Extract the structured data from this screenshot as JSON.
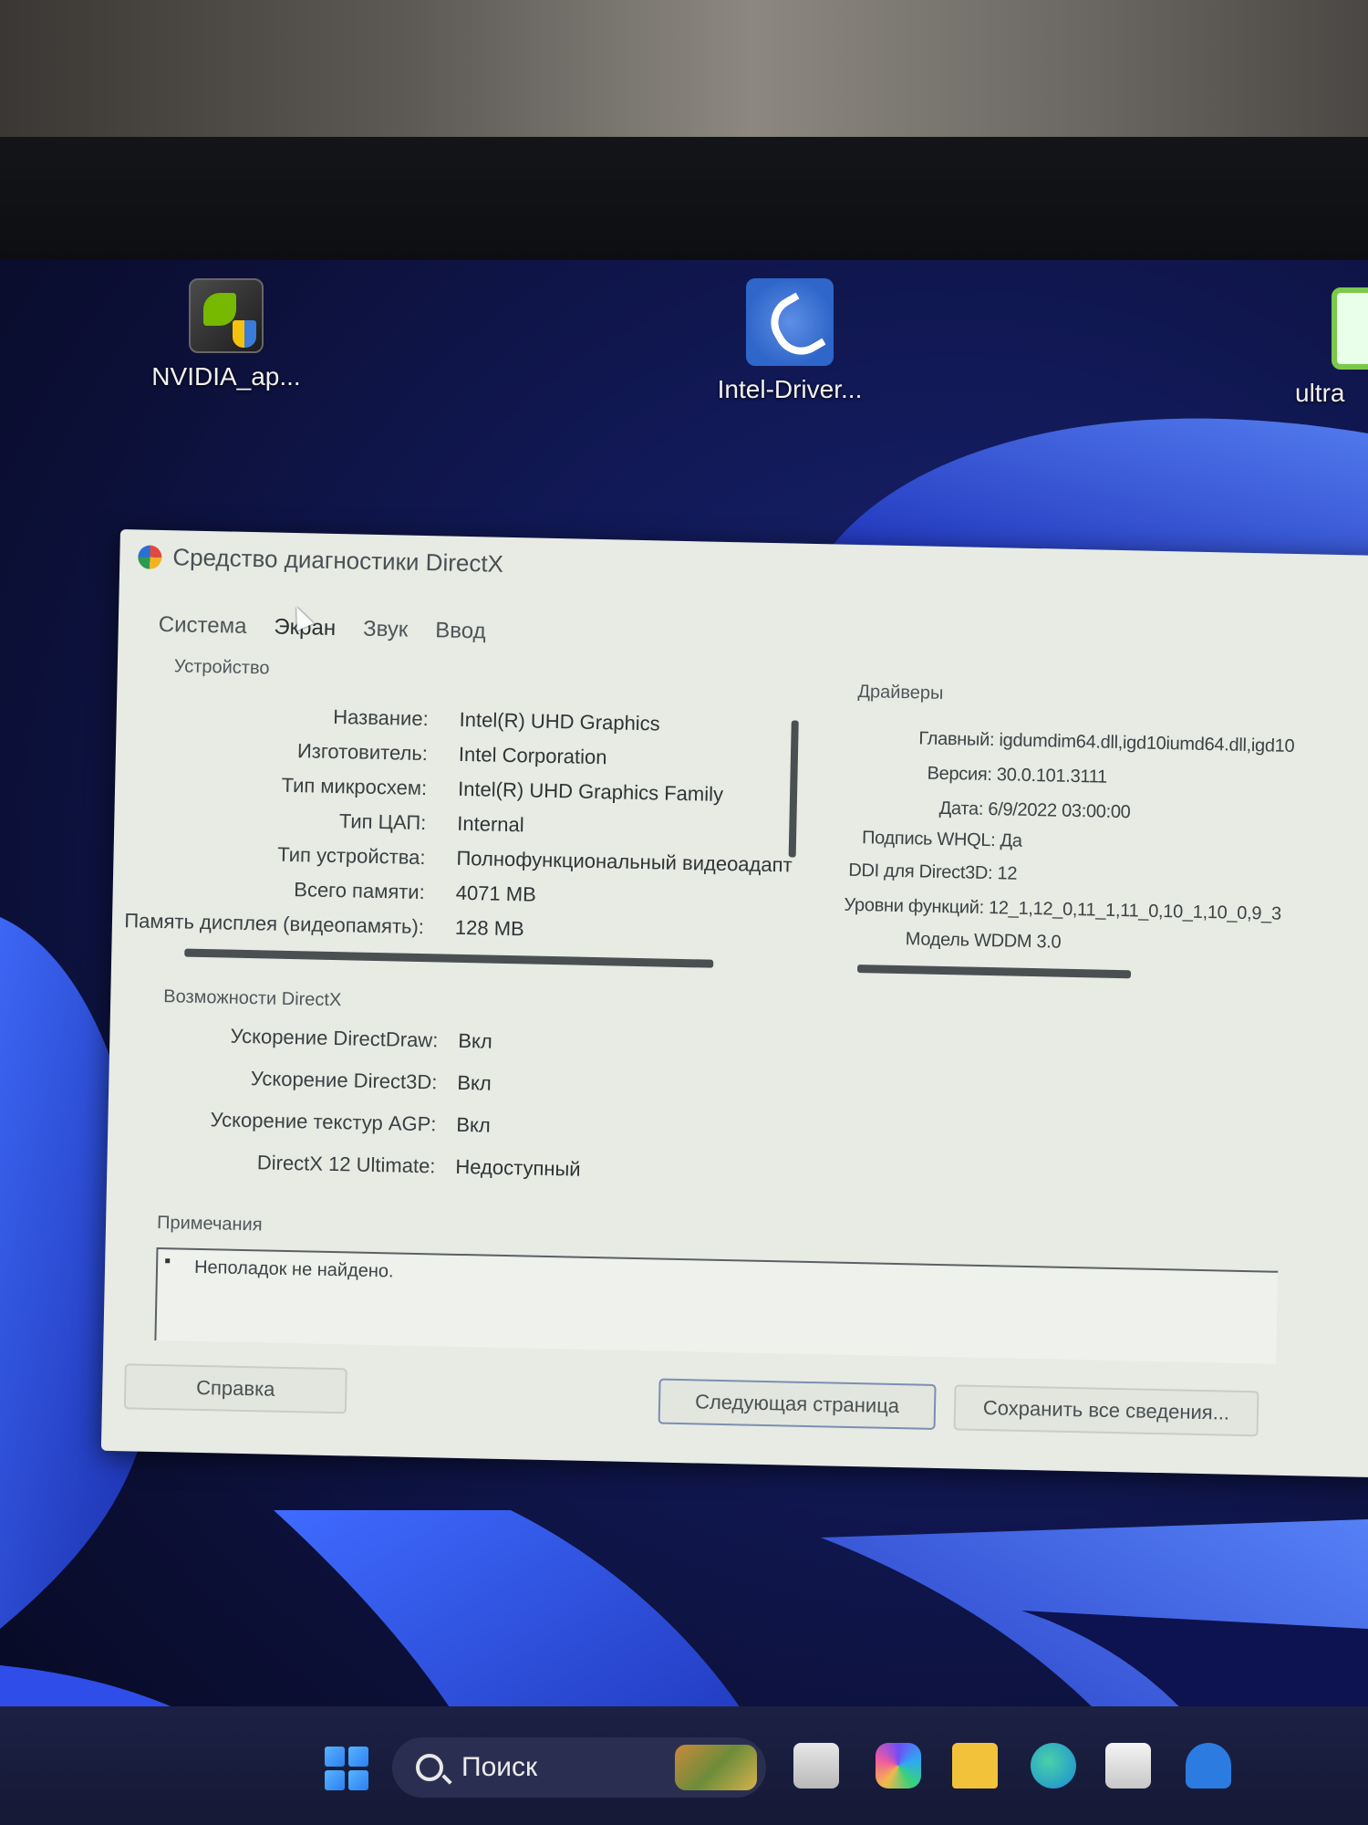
{
  "desktop": {
    "icons": [
      {
        "label": "NVIDIA_ap..."
      },
      {
        "label": "Intel-Driver..."
      },
      {
        "label": "ultra"
      }
    ]
  },
  "window": {
    "title": "Средство диагностики DirectX",
    "tabs": [
      "Система",
      "Экран",
      "Звук",
      "Ввод"
    ],
    "device_group": "Устройство",
    "device": [
      {
        "label": "Название:",
        "value": "Intel(R) UHD Graphics"
      },
      {
        "label": "Изготовитель:",
        "value": "Intel Corporation"
      },
      {
        "label": "Тип микросхем:",
        "value": "Intel(R) UHD Graphics Family"
      },
      {
        "label": "Тип ЦАП:",
        "value": "Internal"
      },
      {
        "label": "Тип устройства:",
        "value": "Полнофункциональный видеоадапт"
      },
      {
        "label": "Всего памяти:",
        "value": "4071 MB"
      },
      {
        "label": "Память дисплея (видеопамять):",
        "value": "128 MB"
      }
    ],
    "drivers_group": "Драйверы",
    "drivers": [
      "Главный: igdumdim64.dll,igd10iumd64.dll,igd10",
      "Версия: 30.0.101.3111",
      "Дата: 6/9/2022 03:00:00",
      "Подпись WHQL: Да",
      "DDI для Direct3D: 12",
      "Уровни функций: 12_1,12_0,11_1,11_0,10_1,10_0,9_3",
      "Модель WDDM 3.0"
    ],
    "caps_group": "Возможности DirectX",
    "caps": [
      {
        "label": "Ускорение DirectDraw:",
        "value": "Вкл"
      },
      {
        "label": "Ускорение Direct3D:",
        "value": "Вкл"
      },
      {
        "label": "Ускорение текстур AGP:",
        "value": "Вкл"
      },
      {
        "label": "DirectX 12 Ultimate:",
        "value": "Недоступный"
      }
    ],
    "notes_group": "Примечания",
    "notes_text": "Неполадок не найдено.",
    "buttons": {
      "help": "Справка",
      "next_page": "Следующая страница",
      "save_all": "Сохранить все сведения..."
    }
  },
  "taskbar": {
    "search_label": "Поиск"
  }
}
